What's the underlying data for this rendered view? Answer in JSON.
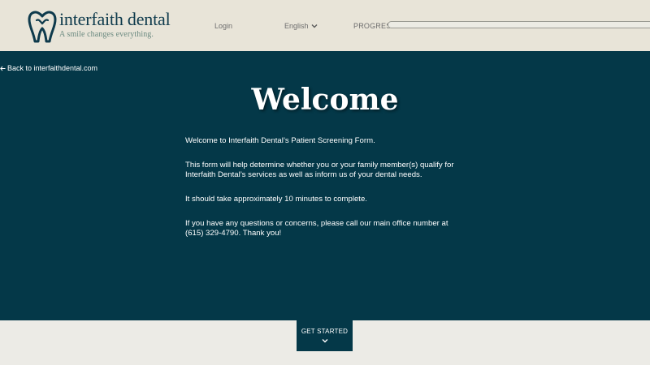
{
  "header": {
    "logo": {
      "name": "interfaith dental",
      "tagline": "A smile changes everything.",
      "icon": "tooth-heart-logo-icon"
    },
    "login_label": "Login",
    "language": {
      "selected": "English",
      "icon": "chevron-down-icon"
    },
    "progress": {
      "label": "PROGRESS",
      "value_fraction": 0.0
    }
  },
  "main": {
    "back_link": {
      "label": "Back to interfaithdental.com",
      "icon": "arrow-left-icon"
    },
    "title": "Welcome",
    "paragraphs": [
      "Welcome to Interfaith Dental’s Patient Screening Form.",
      "This form will help determine whether you or your family member(s) qualify for Interfaith Dental’s services as well as inform us of your dental needs.",
      "It should take approximately 10 minutes to complete.",
      "If you have any questions or concerns, please call our main office number at (615) 329-4790. Thank you!"
    ]
  },
  "footer": {
    "start_button": {
      "label": "GET STARTED",
      "icon": "chevron-down-icon"
    }
  },
  "colors": {
    "brand_dark": "#043848",
    "header_bg": "#e8e4d8",
    "footer_bg": "#ecebe6",
    "tagline": "#6b8a80"
  }
}
